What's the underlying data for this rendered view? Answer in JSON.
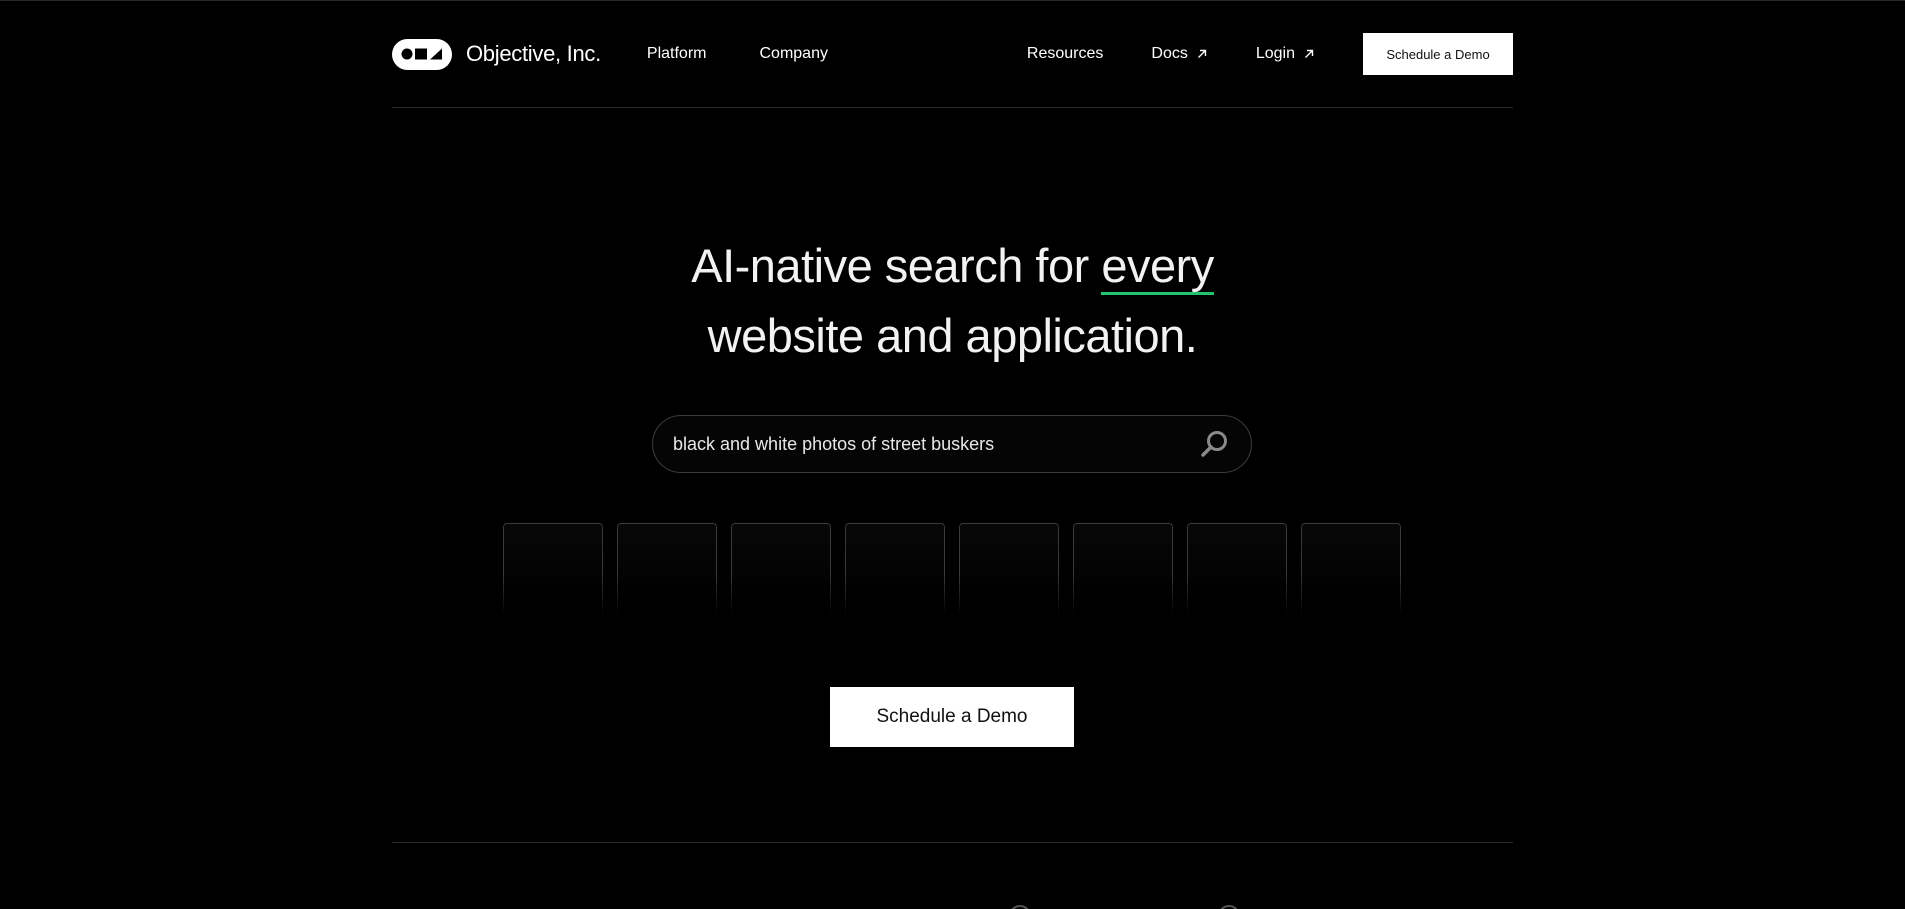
{
  "brand": {
    "name": "Objective, Inc."
  },
  "nav": {
    "left": [
      {
        "label": "Platform"
      },
      {
        "label": "Company"
      }
    ],
    "right": [
      {
        "label": "Resources"
      },
      {
        "label": "Docs"
      },
      {
        "label": "Login"
      }
    ],
    "cta_label": "Schedule a Demo"
  },
  "hero": {
    "title_before": "AI-native search for ",
    "title_emphasis": "every",
    "title_line2": "website and application.",
    "accent_color": "#23c36b"
  },
  "search": {
    "value": "black and white photos of street buskers",
    "icon": "search-icon"
  },
  "cta": {
    "label": "Schedule a Demo"
  },
  "icons": {
    "docs_external": "arrow-up-right-icon",
    "login_external": "arrow-up-right-icon",
    "logo": "logo-mark-icon"
  }
}
